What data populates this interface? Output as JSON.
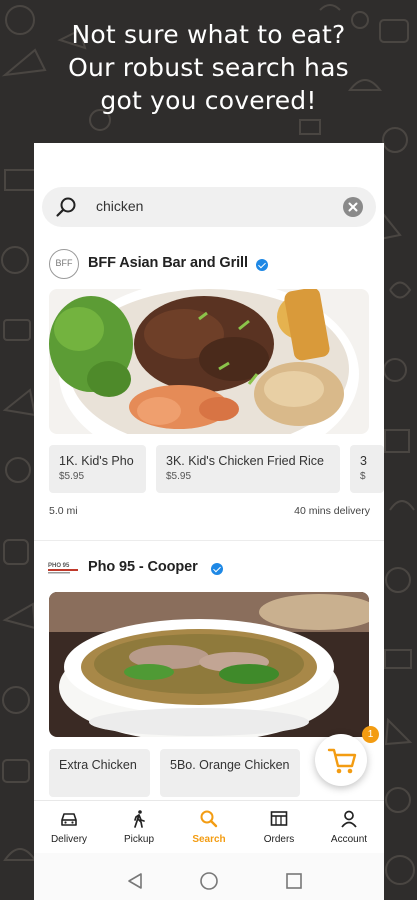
{
  "promo": {
    "headline_line1": "Not sure what to eat?",
    "headline_line2": "Our robust search has",
    "headline_line3": "got you covered!"
  },
  "search": {
    "query": "chicken",
    "icon": "search-icon",
    "clear_icon": "close-icon"
  },
  "restaurants": [
    {
      "name": "BFF Asian Bar and Grill",
      "logo_text": "BFF",
      "verified": true,
      "items": [
        {
          "name": "1K. Kid's Pho",
          "price": "$5.95"
        },
        {
          "name": "3K. Kid's Chicken Fried Rice",
          "price": "$5.95"
        },
        {
          "name": "3",
          "price": "$"
        }
      ],
      "distance": "5.0 mi",
      "delivery_time": "40 mins delivery"
    },
    {
      "name": "Pho 95 - Cooper",
      "logo_text": "PHO 95",
      "verified": true,
      "items": [
        {
          "name": "Extra Chicken",
          "price": ""
        },
        {
          "name": "5Bo. Orange Chicken",
          "price": ""
        }
      ]
    }
  ],
  "cart": {
    "count": "1",
    "icon": "cart-icon"
  },
  "bottom_nav": [
    {
      "label": "Delivery",
      "icon": "car-icon",
      "active": false
    },
    {
      "label": "Pickup",
      "icon": "walking-icon",
      "active": false
    },
    {
      "label": "Search",
      "icon": "search-icon",
      "active": true
    },
    {
      "label": "Orders",
      "icon": "orders-icon",
      "active": false
    },
    {
      "label": "Account",
      "icon": "account-icon",
      "active": false
    }
  ],
  "colors": {
    "accent": "#f39c12",
    "verified": "#1e88e5",
    "background": "#2f2d2c"
  }
}
